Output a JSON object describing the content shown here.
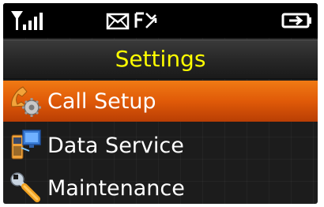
{
  "status_bar": {
    "icons": [
      "signal-strength-icon",
      "new-message-icon",
      "call-forward-icon",
      "battery-icon"
    ]
  },
  "title": "Settings",
  "menu": {
    "selected_index": 0,
    "items": [
      {
        "label": "Call Setup",
        "icon": "call-setup-icon"
      },
      {
        "label": "Data Service",
        "icon": "data-service-icon"
      },
      {
        "label": "Maintenance",
        "icon": "maintenance-icon"
      }
    ]
  },
  "colors": {
    "title_text": "#ffff00",
    "selection": "#e05a08",
    "background": "#1c1c1c"
  }
}
